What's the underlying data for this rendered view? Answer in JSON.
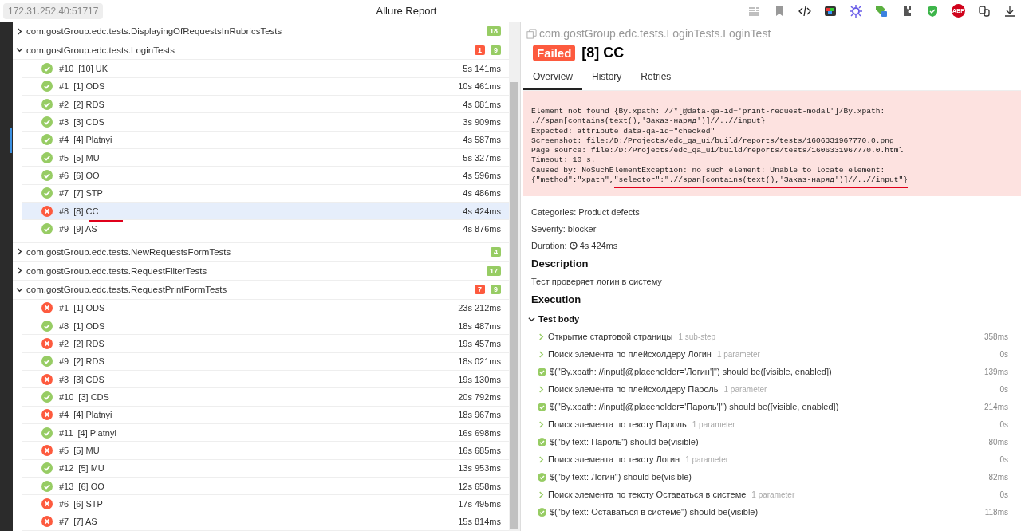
{
  "browser": {
    "address": "172.31.252.40:51717",
    "title": "Allure Report",
    "extensions": [
      {
        "kind": "reader"
      },
      {
        "kind": "bookmark"
      },
      {
        "kind": "code"
      },
      {
        "kind": "colorgrid"
      },
      {
        "kind": "star"
      },
      {
        "kind": "tag"
      },
      {
        "kind": "puzzle"
      },
      {
        "kind": "shield"
      },
      {
        "kind": "abp",
        "label": "ABP"
      },
      {
        "kind": "keys"
      },
      {
        "kind": "download"
      }
    ]
  },
  "tree": [
    {
      "name": "com.gostGroup.edc.tests.DisplayingOfRequestsInRubricsTests",
      "expanded": false,
      "passed": "18"
    },
    {
      "name": "com.gostGroup.edc.tests.LoginTests",
      "expanded": true,
      "failed": "1",
      "passed": "9",
      "tests": [
        {
          "num": "#10",
          "name": "[10] UK",
          "time": "5s 141ms",
          "kind": "passed",
          "selected": false,
          "annotated": false
        },
        {
          "num": "#1",
          "name": "[1] ODS",
          "time": "10s 461ms",
          "kind": "passed",
          "selected": false,
          "annotated": false
        },
        {
          "num": "#2",
          "name": "[2] RDS",
          "time": "4s 081ms",
          "kind": "passed",
          "selected": false,
          "annotated": false
        },
        {
          "num": "#3",
          "name": "[3] CDS",
          "time": "3s 909ms",
          "kind": "passed",
          "selected": false,
          "annotated": false
        },
        {
          "num": "#4",
          "name": "[4] Platnyi",
          "time": "4s 587ms",
          "kind": "passed",
          "selected": false,
          "annotated": false
        },
        {
          "num": "#5",
          "name": "[5] MU",
          "time": "5s 327ms",
          "kind": "passed",
          "selected": false,
          "annotated": false
        },
        {
          "num": "#6",
          "name": "[6] OO",
          "time": "4s 596ms",
          "kind": "passed",
          "selected": false,
          "annotated": false
        },
        {
          "num": "#7",
          "name": "[7] STP",
          "time": "4s 486ms",
          "kind": "passed",
          "selected": false,
          "annotated": false
        },
        {
          "num": "#8",
          "name": "[8] CC",
          "time": "4s 424ms",
          "kind": "failed",
          "selected": true,
          "annotated": true
        },
        {
          "num": "#9",
          "name": "[9] AS",
          "time": "4s 876ms",
          "kind": "passed",
          "selected": false,
          "annotated": false
        }
      ]
    },
    {
      "name": "com.gostGroup.edc.tests.NewRequestsFormTests",
      "expanded": false,
      "passed": "4"
    },
    {
      "name": "com.gostGroup.edc.tests.RequestFilterTests",
      "expanded": false,
      "passed": "17"
    },
    {
      "name": "com.gostGroup.edc.tests.RequestPrintFormTests",
      "expanded": true,
      "failed": "7",
      "passed": "9",
      "tests": [
        {
          "num": "#1",
          "name": "[1] ODS",
          "time": "23s 212ms",
          "kind": "failed",
          "selected": false,
          "annotated": false
        },
        {
          "num": "#8",
          "name": "[1] ODS",
          "time": "18s 487ms",
          "kind": "passed",
          "selected": false,
          "annotated": false
        },
        {
          "num": "#2",
          "name": "[2] RDS",
          "time": "19s 457ms",
          "kind": "failed",
          "selected": false,
          "annotated": false
        },
        {
          "num": "#9",
          "name": "[2] RDS",
          "time": "18s 021ms",
          "kind": "passed",
          "selected": false,
          "annotated": false
        },
        {
          "num": "#3",
          "name": "[3] CDS",
          "time": "19s 130ms",
          "kind": "failed",
          "selected": false,
          "annotated": false
        },
        {
          "num": "#10",
          "name": "[3] CDS",
          "time": "20s 792ms",
          "kind": "passed",
          "selected": false,
          "annotated": false
        },
        {
          "num": "#4",
          "name": "[4] Platnyi",
          "time": "18s 967ms",
          "kind": "failed",
          "selected": false,
          "annotated": false
        },
        {
          "num": "#11",
          "name": "[4] Platnyi",
          "time": "16s 698ms",
          "kind": "passed",
          "selected": false,
          "annotated": false
        },
        {
          "num": "#5",
          "name": "[5] MU",
          "time": "16s 685ms",
          "kind": "failed",
          "selected": false,
          "annotated": false
        },
        {
          "num": "#12",
          "name": "[5] MU",
          "time": "13s 953ms",
          "kind": "passed",
          "selected": false,
          "annotated": false
        },
        {
          "num": "#13",
          "name": "[6] OO",
          "time": "12s 658ms",
          "kind": "passed",
          "selected": false,
          "annotated": false
        },
        {
          "num": "#6",
          "name": "[6] STP",
          "time": "17s 495ms",
          "kind": "failed",
          "selected": false,
          "annotated": false
        },
        {
          "num": "#7",
          "name": "[7] AS",
          "time": "15s 814ms",
          "kind": "failed",
          "selected": false,
          "annotated": false
        }
      ]
    }
  ],
  "detail": {
    "path": "com.gostGroup.edc.tests.LoginTests.LoginTest",
    "status": "Failed",
    "title": "[8] CC",
    "tabs": [
      {
        "label": "Overview",
        "selected": true
      },
      {
        "label": "History",
        "selected": false
      },
      {
        "label": "Retries",
        "selected": false
      }
    ],
    "error": {
      "lines": [
        "Element not found {By.xpath: //*[@data-qa-id='print-request-modal']/By.xpath:",
        ".//span[contains(text(),'Заказ-наряд')]//..//input}",
        "Expected: attribute data-qa-id=\"checked\"",
        "Screenshot: file:/D:/Projects/edc_qa_ui/build/reports/tests/1606331967770.0.png",
        "Page source: file:/D:/Projects/edc_qa_ui/build/reports/tests/1606331967770.0.html",
        "Timeout: 10 s.",
        "Caused by: NoSuchElementException: no such element: Unable to locate element:"
      ],
      "last_line": {
        "prefix": "{\"method\":\"xpath\",",
        "underlined": "\"selector\":\".//span[contains(text(),'Заказ-наряд')]//..//input\"}"
      }
    },
    "categories": "Categories: Product defects",
    "severity": "Severity: blocker",
    "duration_label": "Duration:",
    "duration": "4s 424ms",
    "description_heading": "Description",
    "description": "Тест проверяет логин в систему",
    "execution_heading": "Execution",
    "test_body": {
      "label": "Test body",
      "expanded": true,
      "steps": [
        {
          "kind": "group",
          "text": "Открытие стартовой страницы",
          "meta": "1 sub-step",
          "time": "358ms"
        },
        {
          "kind": "group",
          "text": "Поиск элемента по плейсхолдеру Логин",
          "meta": "1 parameter",
          "time": "0s"
        },
        {
          "kind": "passed",
          "text": "$(\"By.xpath: //input[@placeholder='Логин']\") should be([visible, enabled])",
          "time": "139ms"
        },
        {
          "kind": "group",
          "text": "Поиск элемента по плейсхолдеру Пароль",
          "meta": "1 parameter",
          "time": "0s"
        },
        {
          "kind": "passed",
          "text": "$(\"By.xpath: //input[@placeholder='Пароль']\") should be([visible, enabled])",
          "time": "214ms"
        },
        {
          "kind": "group",
          "text": "Поиск элемента по тексту Пароль",
          "meta": "1 parameter",
          "time": "0s"
        },
        {
          "kind": "passed",
          "text": "$(\"by text: Пароль\") should be(visible)",
          "time": "80ms"
        },
        {
          "kind": "group",
          "text": "Поиск элемента по тексту Логин",
          "meta": "1 parameter",
          "time": "0s"
        },
        {
          "kind": "passed",
          "text": "$(\"by text: Логин\") should be(visible)",
          "time": "82ms"
        },
        {
          "kind": "group",
          "text": "Поиск элемента по тексту Оставаться в системе",
          "meta": "1 parameter",
          "time": "0s"
        },
        {
          "kind": "passed",
          "text": "$(\"by text: Оставаться в системе\") should be(visible)",
          "time": "118ms"
        }
      ]
    }
  }
}
